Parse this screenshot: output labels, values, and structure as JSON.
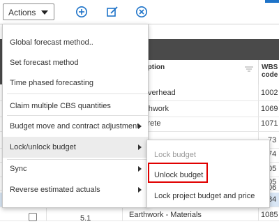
{
  "toolbar": {
    "actions_label": "Actions",
    "icons": [
      "add-circle-icon",
      "edit-icon",
      "cancel-circle-icon"
    ]
  },
  "grid": {
    "columns": {
      "description": "ription",
      "wbs": "WBS",
      "wbs2": "code"
    },
    "rows": [
      {
        "description": "verhead",
        "wbs": "1002",
        "selected": false
      },
      {
        "description": "rthwork",
        "wbs": "1069",
        "selected": false
      },
      {
        "description": "crete",
        "wbs": "1071",
        "selected": false
      },
      {
        "description": "",
        "wbs": "73",
        "selected": false
      },
      {
        "description": "",
        "wbs": "74",
        "selected": false
      },
      {
        "description": "",
        "wbs": "05",
        "selected": false
      },
      {
        "description": "",
        "wbs": "05",
        "selected": false
      },
      {
        "description": "",
        "wbs": "06",
        "selected": false
      },
      {
        "description": "",
        "wbs": "84",
        "selected": true
      },
      {
        "number": "5.1",
        "description": "Earthwork - Materials",
        "wbs": "1085",
        "selected": false
      }
    ]
  },
  "actions_menu": {
    "items": [
      {
        "label": "Global forecast method..",
        "submenu": false
      },
      {
        "label": "Set forecast method",
        "submenu": false
      },
      {
        "label": "Time phased forecasting",
        "submenu": false
      },
      {
        "label": "Claim multiple CBS quantities",
        "submenu": false
      },
      {
        "label": "Budget move and contract adjustment",
        "submenu": true
      },
      {
        "label": "Lock/unlock budget",
        "submenu": true,
        "highlighted": true
      },
      {
        "label": "Sync",
        "submenu": true
      },
      {
        "label": "Reverse estimated actuals",
        "submenu": true
      }
    ]
  },
  "submenu": {
    "items": [
      {
        "label": "Lock budget",
        "disabled": true
      },
      {
        "label": "Unlock budget",
        "disabled": false
      },
      {
        "label": "Lock project budget and price",
        "disabled": false
      }
    ]
  },
  "colors": {
    "accent": "#1e73c8",
    "highlight_box": "#e00000",
    "header_bg": "#4a4a4a"
  }
}
